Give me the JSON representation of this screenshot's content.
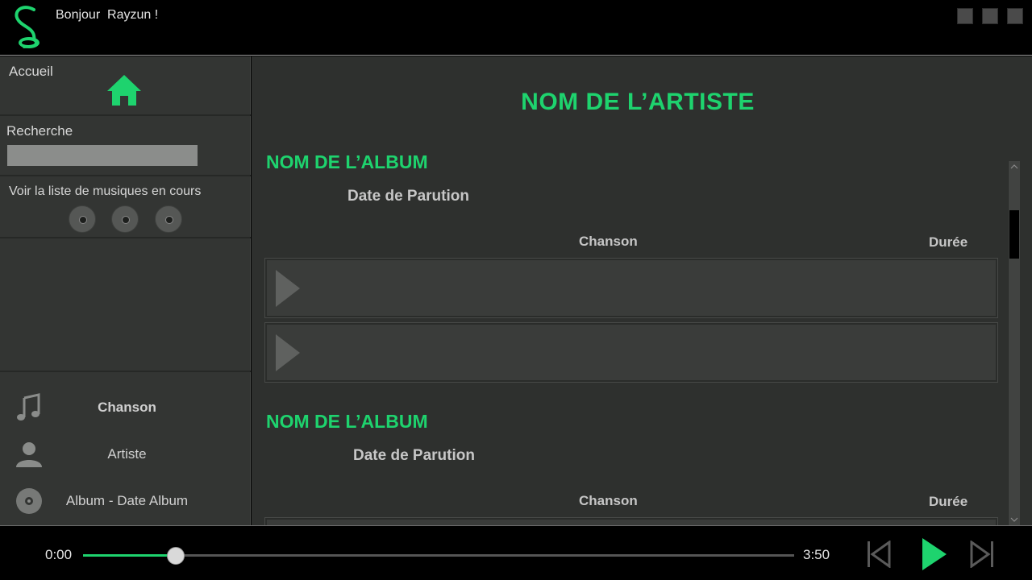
{
  "header": {
    "greeting": "Bonjour  Rayzun !"
  },
  "sidebar": {
    "home_label": "Accueil",
    "search_label": "Recherche",
    "search_value": "",
    "queue_label": "Voir la liste de musiques en cours",
    "now_playing": {
      "song": "Chanson",
      "artist": "Artiste",
      "album": "Album - Date Album"
    }
  },
  "main": {
    "artist_title": "NOM DE L’ARTISTE",
    "albums": [
      {
        "title": "NOM DE L’ALBUM",
        "release_date": "Date de Parution",
        "col_song": "Chanson",
        "col_duration": "Durée"
      },
      {
        "title": "NOM DE L’ALBUM",
        "release_date": "Date de Parution",
        "col_song": "Chanson",
        "col_duration": "Durée"
      }
    ]
  },
  "player": {
    "current_time": "0:00",
    "total_time": "3:50",
    "progress": 0.13
  },
  "colors": {
    "accent": "#1ed36e",
    "sidebar_bg": "#333533",
    "main_bg": "#2e302e"
  }
}
